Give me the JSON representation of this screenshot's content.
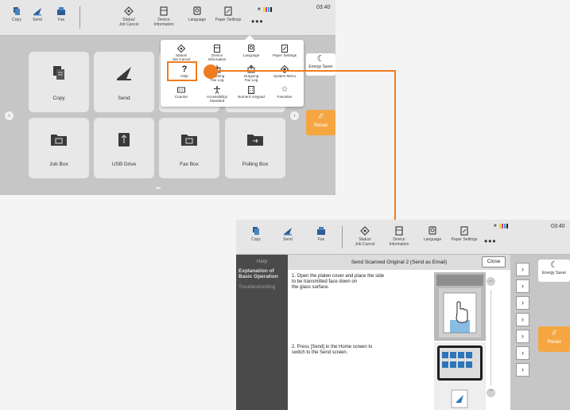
{
  "colors": {
    "accent_orange": "#f07c20",
    "reset_orange": "#f5a640",
    "help_sidebar": "#4a4a4a"
  },
  "screen_a": {
    "toolbar": {
      "items": [
        {
          "label": "Copy",
          "icon": "copy-icon"
        },
        {
          "label": "Send",
          "icon": "send-icon"
        },
        {
          "label": "Fax",
          "icon": "fax-icon"
        },
        {
          "label": "Status/\nJob Cancel",
          "icon": "status-icon"
        },
        {
          "label": "Device\nInformation",
          "icon": "device-info-icon"
        },
        {
          "label": "Language",
          "icon": "language-icon"
        },
        {
          "label": "Paper Settings",
          "icon": "paper-settings-icon"
        }
      ],
      "more": "•••",
      "clock": "03:40"
    },
    "tiles": [
      {
        "label": "Copy",
        "icon": "copy-icon"
      },
      {
        "label": "Send",
        "icon": "send-icon"
      },
      {
        "label": "Job Box",
        "icon": "job-box-icon"
      },
      {
        "label": "USB Drive",
        "icon": "usb-drive-icon"
      },
      {
        "label": "Fax Box",
        "icon": "fax-box-icon"
      },
      {
        "label": "Polling Box",
        "icon": "polling-box-icon"
      }
    ],
    "popup": {
      "items": [
        {
          "label": "Status/\nJob Cancel",
          "icon": "status-icon"
        },
        {
          "label": "Device\nInformation",
          "icon": "device-info-icon"
        },
        {
          "label": "Language",
          "icon": "language-icon"
        },
        {
          "label": "Paper Settings",
          "icon": "paper-settings-icon"
        },
        {
          "label": "Help",
          "icon": "help-icon"
        },
        {
          "label": "Incoming\nFax Log",
          "icon": "incoming-fax-log-icon"
        },
        {
          "label": "Outgoing\nFax Log",
          "icon": "outgoing-fax-log-icon"
        },
        {
          "label": "System Menu",
          "icon": "system-menu-icon"
        },
        {
          "label": "Counter",
          "icon": "counter-icon"
        },
        {
          "label": "Accessibility/\nStandard",
          "icon": "accessibility-icon"
        },
        {
          "label": "Numeric Keypad",
          "icon": "numeric-keypad-icon"
        },
        {
          "label": "Favorites",
          "icon": "favorites-icon"
        }
      ]
    },
    "energy_saver": "Energy Saver",
    "reset": "Reset"
  },
  "screen_b": {
    "toolbar": {
      "items": [
        {
          "label": "Copy",
          "icon": "copy-icon"
        },
        {
          "label": "Send",
          "icon": "send-icon"
        },
        {
          "label": "Fax",
          "icon": "fax-icon"
        },
        {
          "label": "Status/\nJob Cancel",
          "icon": "status-icon"
        },
        {
          "label": "Device\nInformation",
          "icon": "device-info-icon"
        },
        {
          "label": "Language",
          "icon": "language-icon"
        },
        {
          "label": "Paper Settings",
          "icon": "paper-settings-icon"
        }
      ],
      "more": "•••",
      "clock": "03:40"
    },
    "help": {
      "sidebar_title": "Help",
      "nav": [
        {
          "label": "Explanation of\nBasic Operation",
          "active": true
        },
        {
          "label": "Troubleshooting",
          "active": false
        }
      ],
      "header_title": "Send Scanned Original 2 (Send as Email)",
      "close": "Close",
      "steps": [
        "1. Open the platen cover and place the side\n    to be transmitted face down on\n    the glass surface.",
        "2. Press [Send] in the Home screen to\n    switch to the Send screen."
      ]
    },
    "energy_saver": "Energy Saver",
    "reset": "Reset"
  }
}
